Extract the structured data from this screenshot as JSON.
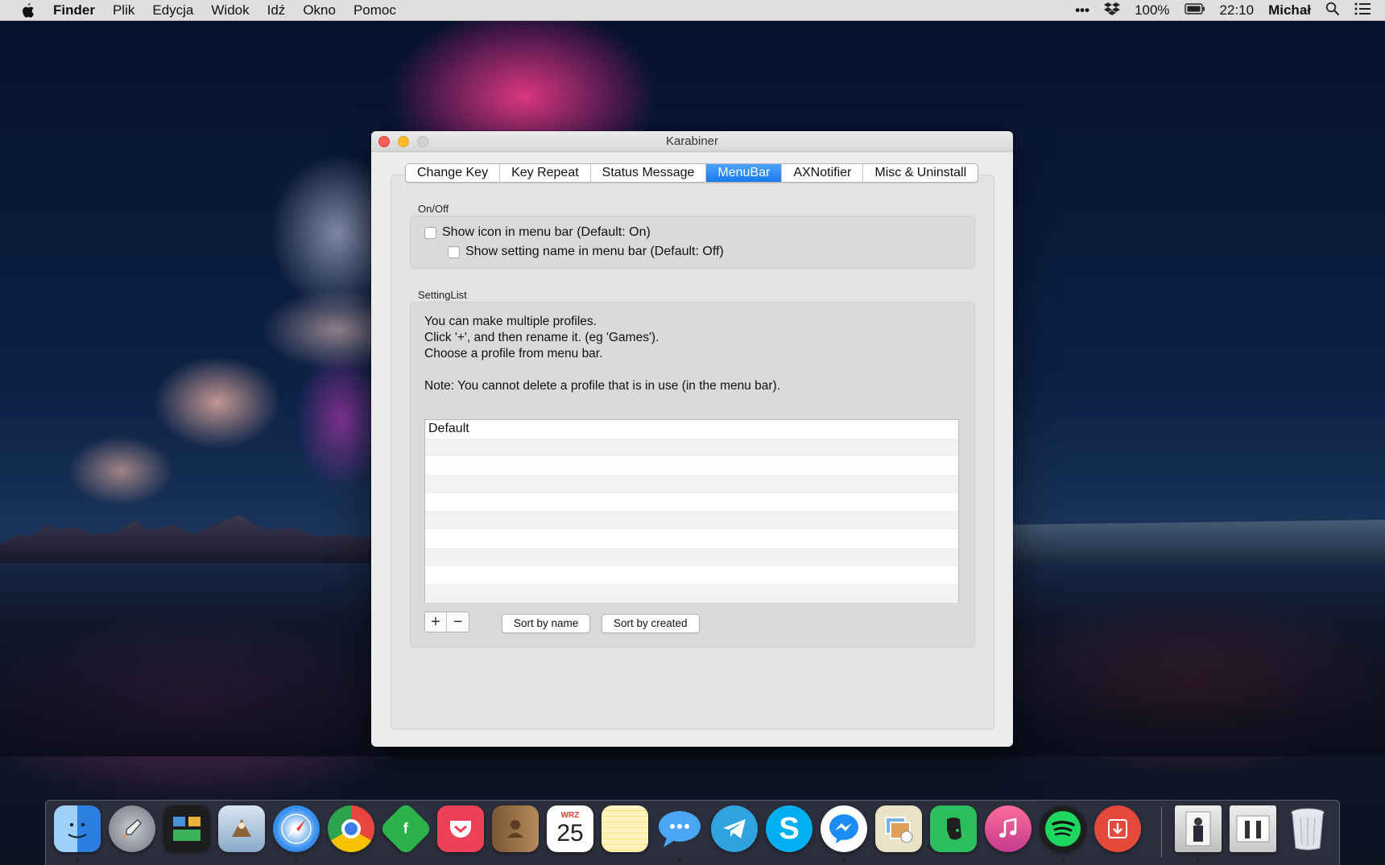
{
  "menubar": {
    "app_name": "Finder",
    "items": [
      "Plik",
      "Edycja",
      "Widok",
      "Idź",
      "Okno",
      "Pomoc"
    ],
    "right": {
      "more": "•••",
      "battery_percent": "100%",
      "time": "22:10",
      "user": "Michał"
    }
  },
  "window": {
    "title": "Karabiner",
    "tabs": [
      "Change Key",
      "Key Repeat",
      "Status Message",
      "MenuBar",
      "AXNotifier",
      "Misc & Uninstall"
    ],
    "active_tab": "MenuBar",
    "onoff": {
      "label": "On/Off",
      "show_icon": "Show icon in menu bar (Default: On)",
      "show_setting_name": "Show setting name in menu bar (Default: Off)"
    },
    "settinglist": {
      "label": "SettingList",
      "info_lines": [
        "You can make multiple profiles.",
        "Click '+', and then rename it. (eg 'Games').",
        "Choose a profile from menu bar.",
        "Note: You cannot delete a profile that is in use (in the menu bar)."
      ],
      "profiles": [
        "Default",
        "",
        "",
        "",
        "",
        "",
        "",
        "",
        "",
        ""
      ],
      "add_label": "+",
      "remove_label": "−",
      "sort_by_name": "Sort by name",
      "sort_by_created": "Sort by created"
    }
  },
  "dock": {
    "calendar_month": "WRZ",
    "calendar_day": "25",
    "apps": [
      "finder",
      "launchpad",
      "mission-control",
      "mail",
      "safari",
      "chrome",
      "feedly",
      "pocket",
      "contacts",
      "calendar",
      "notes",
      "messages",
      "telegram",
      "skype",
      "messenger",
      "preview",
      "evernote",
      "itunes",
      "spotify",
      "transmit",
      "photo-stack",
      "photo-stack",
      "trash"
    ],
    "colors": {
      "finder": "#3b8fe8",
      "launchpad": "#8a8f99",
      "mission-control": "#2a2a2a",
      "mail": "#9bb6d6",
      "safari": "#2d86e6",
      "chrome": "#e8453c",
      "feedly": "#2bb24c",
      "pocket": "#ee4056",
      "contacts": "#a27b52",
      "calendar": "#ffffff",
      "notes": "#fbe27a",
      "messages": "#4aa7f5",
      "telegram": "#2fa2df",
      "skype": "#00aff0",
      "messenger": "#1c8cf5",
      "preview": "#e9e2c6",
      "evernote": "#2dbe60",
      "itunes": "#f25a8d",
      "spotify": "#1ed760",
      "transmit": "#e4493b",
      "trash": "#d8dde3"
    }
  }
}
